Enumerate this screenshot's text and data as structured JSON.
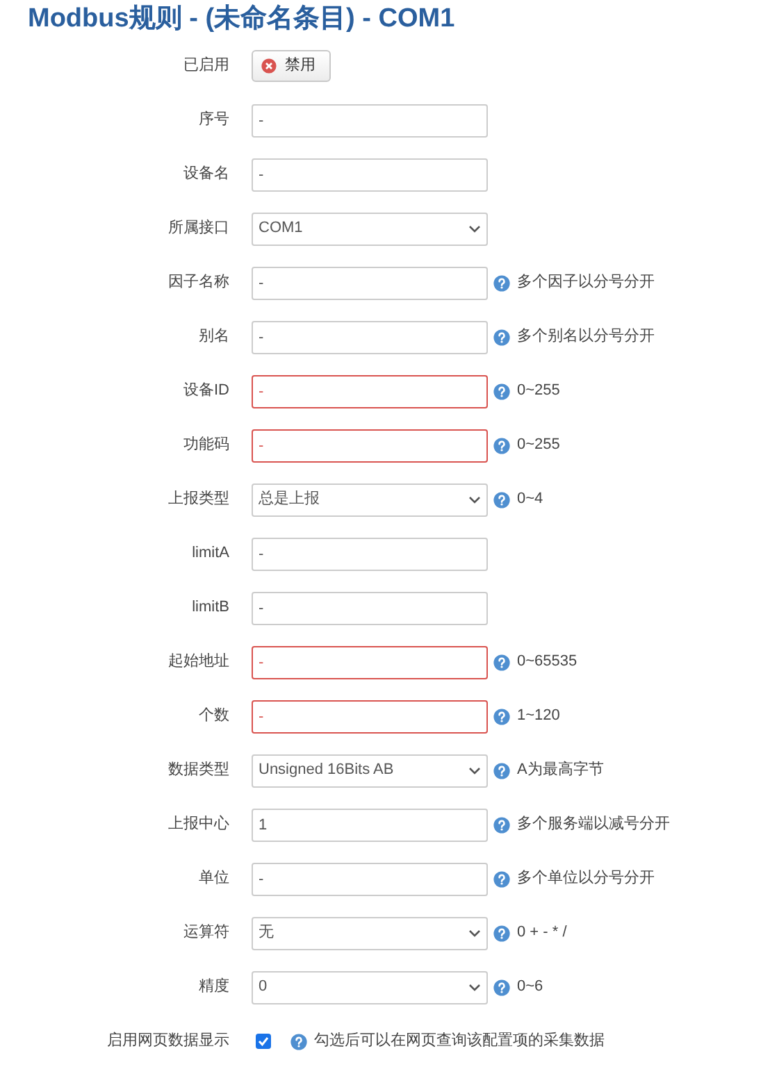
{
  "title": "Modbus规则 - (未命名条目) - COM1",
  "rows": [
    {
      "kind": "button",
      "label": "已启用",
      "value": "禁用"
    },
    {
      "kind": "text",
      "label": "序号",
      "value": "-",
      "invalid": false
    },
    {
      "kind": "text",
      "label": "设备名",
      "value": "-",
      "invalid": false
    },
    {
      "kind": "select",
      "label": "所属接口",
      "value": "COM1"
    },
    {
      "kind": "text",
      "label": "因子名称",
      "value": "-",
      "invalid": false,
      "hint": "多个因子以分号分开"
    },
    {
      "kind": "text",
      "label": "别名",
      "value": "-",
      "invalid": false,
      "hint": "多个别名以分号分开"
    },
    {
      "kind": "text",
      "label": "设备ID",
      "value": "-",
      "invalid": true,
      "hint": "0~255"
    },
    {
      "kind": "text",
      "label": "功能码",
      "value": "-",
      "invalid": true,
      "hint": "0~255"
    },
    {
      "kind": "select",
      "label": "上报类型",
      "value": "总是上报",
      "hint": "0~4"
    },
    {
      "kind": "text",
      "label": "limitA",
      "value": "-",
      "invalid": false
    },
    {
      "kind": "text",
      "label": "limitB",
      "value": "-",
      "invalid": false
    },
    {
      "kind": "text",
      "label": "起始地址",
      "value": "-",
      "invalid": true,
      "hint": "0~65535"
    },
    {
      "kind": "text",
      "label": "个数",
      "value": "-",
      "invalid": true,
      "hint": "1~120"
    },
    {
      "kind": "select",
      "label": "数据类型",
      "value": "Unsigned 16Bits AB",
      "hint": "A为最高字节"
    },
    {
      "kind": "text",
      "label": "上报中心",
      "value": "1",
      "invalid": false,
      "hint": "多个服务端以减号分开"
    },
    {
      "kind": "text",
      "label": "单位",
      "value": "-",
      "invalid": false,
      "hint": "多个单位以分号分开"
    },
    {
      "kind": "select",
      "label": "运算符",
      "value": "无",
      "hint": "0 + - * /"
    },
    {
      "kind": "select",
      "label": "精度",
      "value": "0",
      "hint": "0~6"
    },
    {
      "kind": "checkbox",
      "label": "启用网页数据显示",
      "checked": true,
      "hint": "勾选后可以在网页查询该配置项的采集数据"
    }
  ]
}
